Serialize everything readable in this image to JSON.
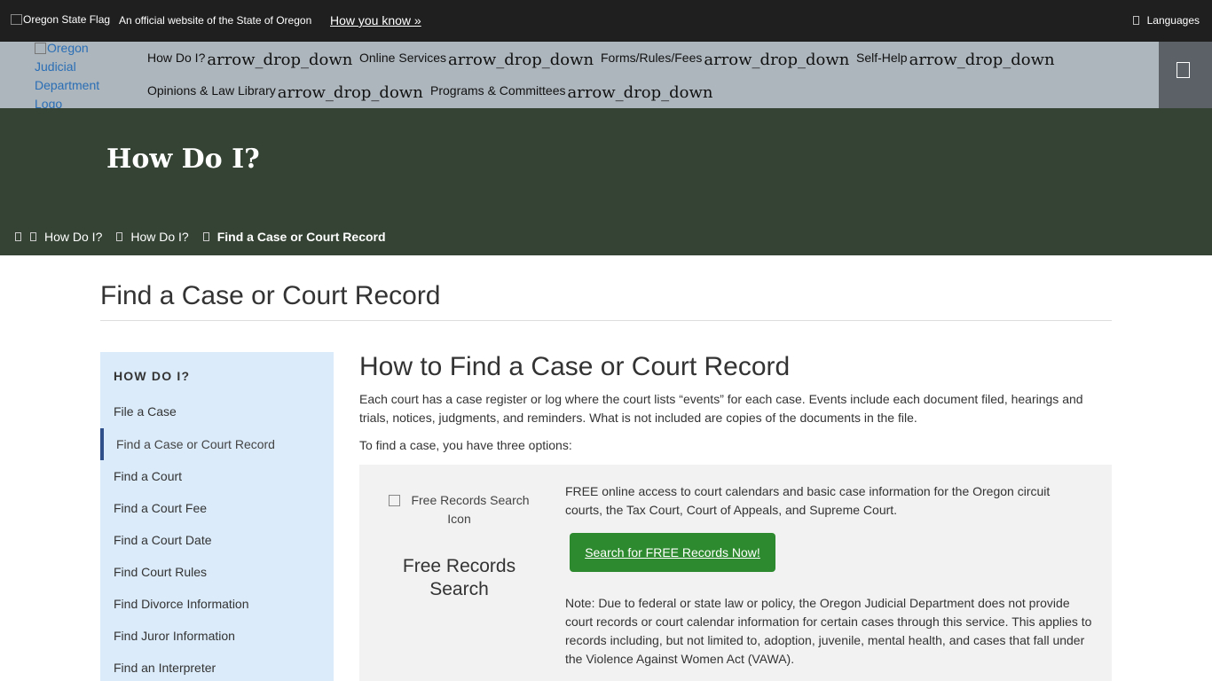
{
  "gov_banner": {
    "flag_alt": "Oregon State Flag",
    "official_text": "An official website of the State of Oregon",
    "how_you_know": "How you know »",
    "languages": "Languages"
  },
  "nav": {
    "logo_alt": "Oregon Judicial Department Logo",
    "arrow_text": "arrow_drop_down",
    "items": [
      {
        "label": "How Do I?"
      },
      {
        "label": "Online Services"
      },
      {
        "label": "Forms/Rules/Fees"
      },
      {
        "label": "Self-Help"
      },
      {
        "label": "Opinions & Law Library"
      },
      {
        "label": "Programs & Committees"
      }
    ]
  },
  "hero": {
    "title": "How Do I?",
    "breadcrumbs": [
      "How Do I?",
      "How Do I?",
      "Find a Case or Court Record"
    ]
  },
  "page": {
    "title": "Find a Case or Court Record"
  },
  "sidebar": {
    "heading": "HOW DO I?",
    "items": [
      {
        "label": "File a Case"
      },
      {
        "label": "Find a Case or Court Record",
        "active": true
      },
      {
        "label": "Find a Court"
      },
      {
        "label": "Find a Court Fee"
      },
      {
        "label": "Find a Court Date"
      },
      {
        "label": "Find Court Rules"
      },
      {
        "label": "Find Divorce Information"
      },
      {
        "label": "Find Juror Information"
      },
      {
        "label": "Find an Interpreter"
      }
    ]
  },
  "main": {
    "heading": "How to Find a Case or Court Record",
    "intro": "Each court has a case register or log where the court lists “events” for each case. Events include each document filed, hearings and trials, notices, judgments, and reminders. What is not included are copies of the documents in the file.",
    "options_text": "To find a case, you have three options:",
    "panel": {
      "icon_alt": "Free Records Search Icon",
      "label": "Free Records Search",
      "description": "FREE online access to court calendars and basic case information for the Oregon circuit courts, the Tax Court, Court of Appeals, and Supreme Court.",
      "button_label": "Search for FREE Records Now!",
      "note": "Note: Due to federal or state law or policy, the Oregon Judicial Department does not provide court records or court calendar information for certain cases through this service. This applies to records including, but not limited to, adoption, juvenile, mental health, and cases that fall under the Violence Against Women Act (VAWA)."
    }
  },
  "colors": {
    "gov_bar": "#1f1f1f",
    "nav_bg": "#adb6bd",
    "hero_bg": "#344334",
    "sidebar_bg": "#dbebfa",
    "button_green": "#2e8a2e"
  }
}
